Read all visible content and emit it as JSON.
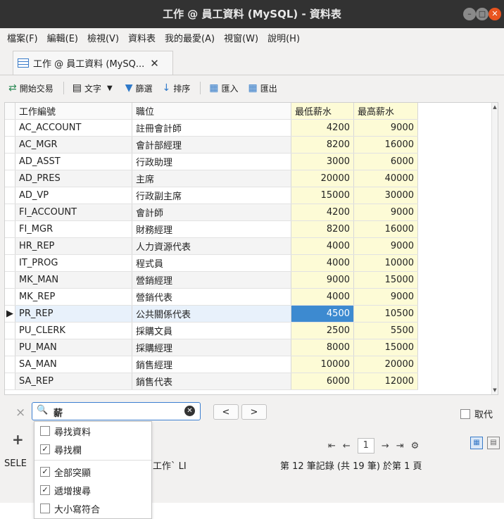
{
  "window": {
    "title": "工作 @ 員工資料 (MySQL) - 資料表",
    "btn_min": "–",
    "btn_max": "□",
    "btn_close": "✕"
  },
  "menu": [
    "檔案(F)",
    "編輯(E)",
    "檢視(V)",
    "資料表",
    "我的最愛(A)",
    "視窗(W)",
    "說明(H)"
  ],
  "tab": {
    "label": "工作 @ 員工資料 (MySQ...",
    "close": "✕"
  },
  "toolbar": {
    "begin_transaction": "開始交易",
    "text": "文字",
    "filter": "篩選",
    "sort": "排序",
    "import": "匯入",
    "export": "匯出"
  },
  "grid": {
    "columns": [
      "工作編號",
      "職位",
      "最低薪水",
      "最高薪水"
    ],
    "rows": [
      [
        "AC_ACCOUNT",
        "註冊會計師",
        "4200",
        "9000"
      ],
      [
        "AC_MGR",
        "會計部經理",
        "8200",
        "16000"
      ],
      [
        "AD_ASST",
        "行政助理",
        "3000",
        "6000"
      ],
      [
        "AD_PRES",
        "主席",
        "20000",
        "40000"
      ],
      [
        "AD_VP",
        "行政副主席",
        "15000",
        "30000"
      ],
      [
        "FI_ACCOUNT",
        "會計師",
        "4200",
        "9000"
      ],
      [
        "FI_MGR",
        "財務經理",
        "8200",
        "16000"
      ],
      [
        "HR_REP",
        "人力資源代表",
        "4000",
        "9000"
      ],
      [
        "IT_PROG",
        "程式員",
        "4000",
        "10000"
      ],
      [
        "MK_MAN",
        "營銷經理",
        "9000",
        "15000"
      ],
      [
        "MK_REP",
        "營銷代表",
        "4000",
        "9000"
      ],
      [
        "PR_REP",
        "公共關係代表",
        "4500",
        "10500"
      ],
      [
        "PU_CLERK",
        "採購文員",
        "2500",
        "5500"
      ],
      [
        "PU_MAN",
        "採購經理",
        "8000",
        "15000"
      ],
      [
        "SA_MAN",
        "銷售經理",
        "10000",
        "20000"
      ],
      [
        "SA_REP",
        "銷售代表",
        "6000",
        "12000"
      ]
    ],
    "selected_row_index": 11,
    "row_indicator": "▶"
  },
  "find": {
    "value": "薪",
    "prev": "<",
    "next": ">",
    "replace_label": "取代",
    "close": "×"
  },
  "dropdown": [
    {
      "label": "尋找資料",
      "checked": false
    },
    {
      "label": "尋找欄",
      "checked": true
    },
    {
      "label": "全部突顯",
      "checked": true
    },
    {
      "label": "遞增搜尋",
      "checked": true
    },
    {
      "label": "大小寫符合",
      "checked": false
    }
  ],
  "pager": {
    "first": "⇤",
    "prev": "←",
    "page": "1",
    "next": "→",
    "last": "⇥",
    "settings": "⚙"
  },
  "status": {
    "left": "SELE",
    "mid": "工作` LI",
    "right": "第 12 筆記錄 (共 19 筆) 於第 1 頁"
  },
  "colors": {
    "accent": "#3d8ad0",
    "highlight_col": "#fdfbd6",
    "titlebar": "#323232"
  }
}
